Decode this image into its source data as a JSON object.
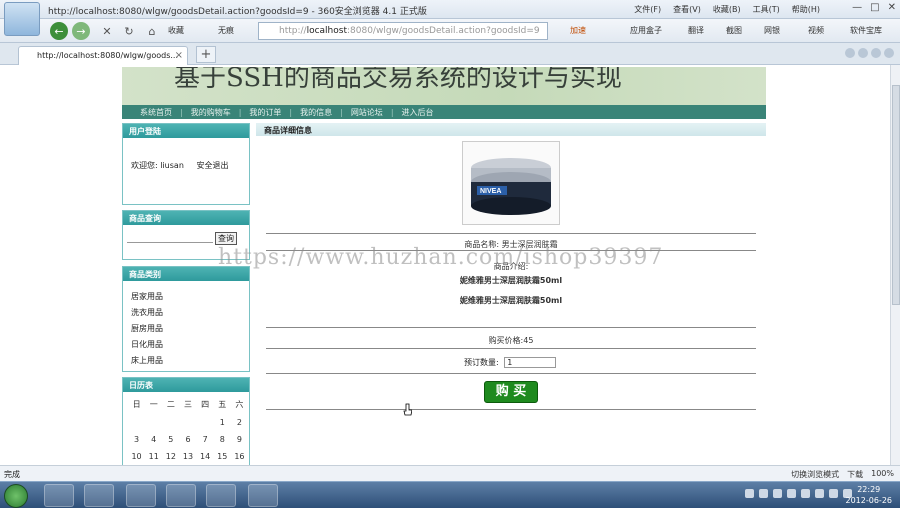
{
  "window": {
    "title": "http://localhost:8080/wlgw/goodsDetail.action?goodsId=9 - 360安全浏览器 4.1 正式版",
    "menus": [
      "文件(F)",
      "查看(V)",
      "收藏(B)",
      "工具(T)",
      "帮助(H)"
    ],
    "controls": [
      "—",
      "□",
      "✕"
    ]
  },
  "toolbar": {
    "back": "←",
    "forward": "→",
    "stop": "✕",
    "refresh": "↻",
    "home": "⌂",
    "favorites": "收藏",
    "unknown": "无痕",
    "address": "http://localhost:8080/wlgw/goodsDetail.action?goodsId=9",
    "address_host": "localhost",
    "address_rest": ":8080/wlgw/goodsDetail.action?goodsId=9",
    "accelerate": "加速",
    "apps": "应用盒子",
    "translate": "翻译",
    "screenshot": "截图",
    "netbank": "网银",
    "video": "视频",
    "software": "软件宝库"
  },
  "tab": {
    "label": "http://localhost:8080/wlgw/goods..."
  },
  "banner": {
    "title": "基于SSH的商品交易系统的设计与实现"
  },
  "nav": [
    "系统首页",
    "我的购物车",
    "我的订单",
    "我的信息",
    "网站论坛",
    "进入后台"
  ],
  "login": {
    "title": "用户登陆",
    "welcome": "欢迎您: liusan",
    "logout": "安全退出"
  },
  "search": {
    "title": "商品查询",
    "button": "查询"
  },
  "category": {
    "title": "商品类别",
    "items": [
      "居家用品",
      "洗衣用品",
      "厨房用品",
      "日化用品",
      "床上用品"
    ]
  },
  "calendar": {
    "title": "日历表",
    "weekdays": [
      "日",
      "一",
      "二",
      "三",
      "四",
      "五",
      "六"
    ],
    "row1": [
      "",
      "",
      "",
      "",
      "",
      "1",
      "2"
    ],
    "row2": [
      "3",
      "4",
      "5",
      "6",
      "7",
      "8",
      "9"
    ],
    "row3": [
      "10",
      "11",
      "12",
      "13",
      "14",
      "15",
      "16"
    ]
  },
  "main": {
    "title": "商品详细信息",
    "name_label": "商品名称: 男士深层润肤霜",
    "intro_label": "商品介绍:",
    "intro_line1": "妮维雅男士深层润肤霜50ml",
    "intro_line2": "妮维雅男士深层润肤霜50ml",
    "price_label": "购买价格:45",
    "qty_label": "预订数量:",
    "qty_value": "1",
    "buy": "购 买",
    "product_brand": "NIVEA"
  },
  "watermark": "https://www.huzhan.com/ishop39397",
  "status": {
    "left": "完成",
    "mode": "切换浏览模式",
    "download": "下载",
    "zoom": "100%"
  },
  "clock": {
    "time": "22:29",
    "date": "2012-06-26"
  }
}
